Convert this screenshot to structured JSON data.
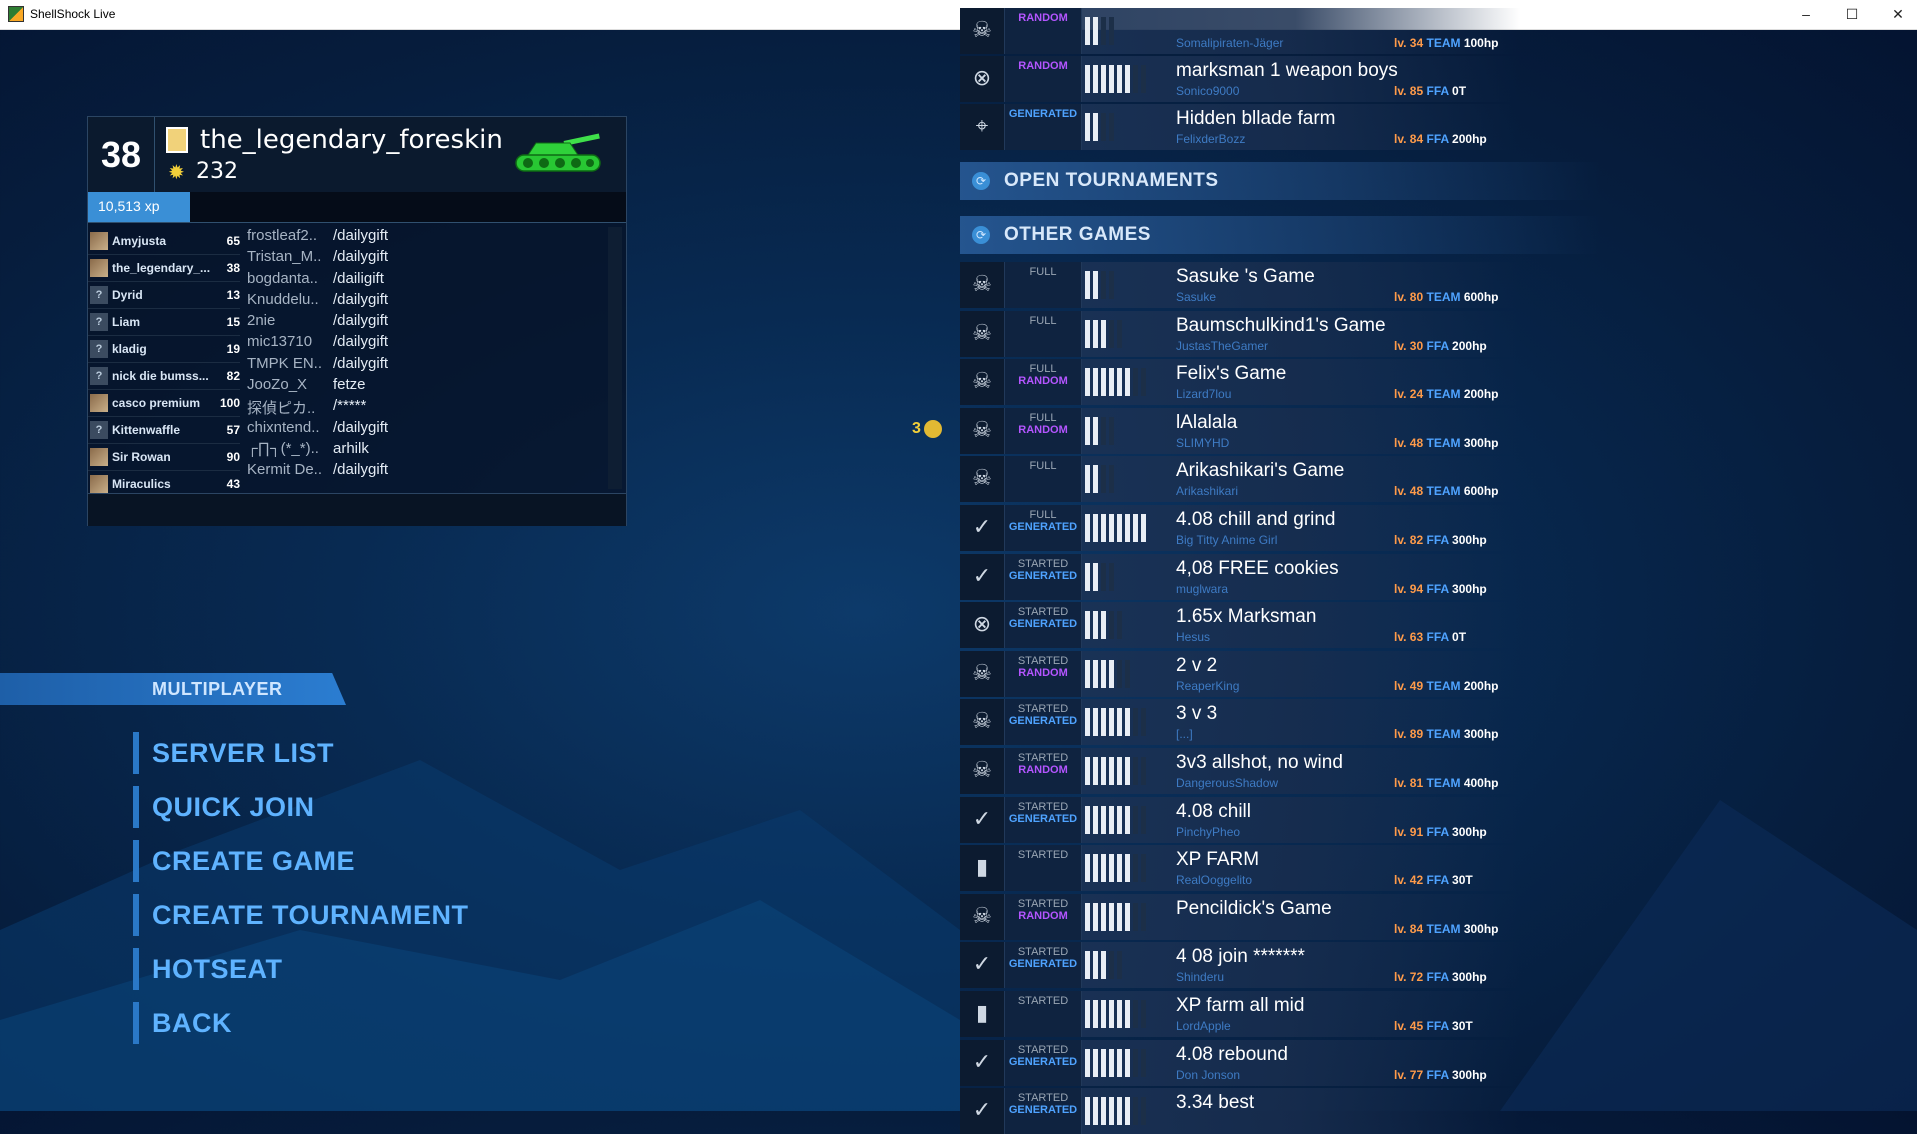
{
  "window": {
    "title": "ShellShock Live",
    "minimize": "–",
    "maximize": "☐",
    "close": "✕"
  },
  "player": {
    "level": "38",
    "name": "the_legendary_foreskin",
    "coins": "232",
    "xp_label": "10,513 xp",
    "xp_fraction": 0.19
  },
  "friends": [
    {
      "name": "Amyjusta",
      "level": "65",
      "avatar": "img"
    },
    {
      "name": "the_legendary_...",
      "level": "38",
      "avatar": "img"
    },
    {
      "name": "Dyrid",
      "level": "13",
      "avatar": "?"
    },
    {
      "name": "Liam",
      "level": "15",
      "avatar": "?"
    },
    {
      "name": "kladig",
      "level": "19",
      "avatar": "?"
    },
    {
      "name": "nick die bumss...",
      "level": "82",
      "avatar": "?"
    },
    {
      "name": "casco premium",
      "level": "100",
      "avatar": "img"
    },
    {
      "name": "Kittenwaffle",
      "level": "57",
      "avatar": "?"
    },
    {
      "name": "Sir Rowan",
      "level": "90",
      "avatar": "img"
    },
    {
      "name": "Miraculics",
      "level": "43",
      "avatar": "img"
    }
  ],
  "chat": [
    {
      "user": "frostleaf2..",
      "msg": "/dailygift"
    },
    {
      "user": "Tristan_M..",
      "msg": "/dailygift"
    },
    {
      "user": "bogdanta..",
      "msg": "/dailigift"
    },
    {
      "user": "Knuddelu..",
      "msg": "/dailygift"
    },
    {
      "user": "2nie",
      "msg": "/dailygift"
    },
    {
      "user": "mic13710",
      "msg": "/dailygift"
    },
    {
      "user": "TMPK EN..",
      "msg": "/dailygift"
    },
    {
      "user": "JooZo_X",
      "msg": "fetze"
    },
    {
      "user": "探偵ピカ..",
      "msg": "/*****"
    },
    {
      "user": "chixntend..",
      "msg": "/dailygift"
    },
    {
      "user": "┌∏┐(*_*)..",
      "msg": "arhilk"
    },
    {
      "user": "Kermit De..",
      "msg": "/dailygift"
    }
  ],
  "menu": {
    "header": "MULTIPLAYER",
    "items": [
      "SERVER LIST",
      "QUICK JOIN",
      "CREATE GAME",
      "CREATE TOURNAMENT",
      "HOTSEAT",
      "BACK"
    ]
  },
  "sections": {
    "open_tournaments": "OPEN TOURNAMENTS",
    "other_games": "OTHER GAMES"
  },
  "coin_indicator": {
    "count": "3"
  },
  "top_games": [
    {
      "icon": "☠",
      "status": "",
      "type": "RANDOM",
      "type_color": "#b455ff",
      "bars": 2,
      "name": "",
      "owner": "Somalipiraten-Jäger",
      "level": "lv. 34",
      "mode": "TEAM",
      "hp": "100hp"
    },
    {
      "icon": "⊗",
      "status": "",
      "type": "RANDOM",
      "type_color": "#b455ff",
      "bars": 6,
      "name": "marksman 1 weapon boys",
      "owner": "Sonico9000",
      "level": "lv. 85",
      "mode": "FFA",
      "hp": "0T"
    },
    {
      "icon": "⌖",
      "status": "",
      "type": "GENERATED",
      "type_color": "#4fa3ff",
      "bars": 2,
      "name": "Hidden bllade farm",
      "owner": "FelixderBozz",
      "level": "lv. 84",
      "mode": "FFA",
      "hp": "200hp"
    }
  ],
  "other_games": [
    {
      "icon": "☠",
      "status": "FULL",
      "type": "",
      "bars": 2,
      "name": "Sasuke   's Game",
      "owner": "Sasuke",
      "level": "lv. 80",
      "mode": "TEAM",
      "hp": "600hp"
    },
    {
      "icon": "☠",
      "status": "FULL",
      "type": "",
      "bars": 3,
      "name": "Baumschulkind1's Game",
      "owner": "JustasTheGamer",
      "level": "lv. 30",
      "mode": "FFA",
      "hp": "200hp"
    },
    {
      "icon": "☠",
      "status": "FULL",
      "type": "RANDOM",
      "bars": 6,
      "name": "Felix's Game",
      "owner": "Lizard7lou",
      "level": "lv. 24",
      "mode": "TEAM",
      "hp": "200hp"
    },
    {
      "icon": "☠",
      "status": "FULL",
      "type": "RANDOM",
      "bars": 2,
      "name": "lAlalala",
      "owner": "SLIMYHD",
      "level": "lv. 48",
      "mode": "TEAM",
      "hp": "300hp"
    },
    {
      "icon": "☠",
      "status": "FULL",
      "type": "",
      "bars": 2,
      "name": "Arikashikari's Game",
      "owner": "Arikashikari",
      "level": "lv. 48",
      "mode": "TEAM",
      "hp": "600hp"
    },
    {
      "icon": "✓",
      "status": "FULL",
      "type": "GENERATED",
      "bars": 8,
      "name": "4.08 chill and grind",
      "owner": "Big Titty Anime Girl",
      "level": "lv. 82",
      "mode": "FFA",
      "hp": "300hp"
    },
    {
      "icon": "✓",
      "status": "STARTED",
      "type": "GENERATED",
      "bars": 2,
      "name": "4,08 FREE cookies",
      "owner": "muglwara",
      "level": "lv. 94",
      "mode": "FFA",
      "hp": "300hp"
    },
    {
      "icon": "⊗",
      "status": "STARTED",
      "type": "GENERATED",
      "bars": 3,
      "name": "1.65x Marksman",
      "owner": "Hesus",
      "level": "lv. 63",
      "mode": "FFA",
      "hp": "0T"
    },
    {
      "icon": "☠",
      "status": "STARTED",
      "type": "RANDOM",
      "bars": 4,
      "name": "2 v 2",
      "owner": "ReaperKing",
      "level": "lv. 49",
      "mode": "TEAM",
      "hp": "200hp"
    },
    {
      "icon": "☠",
      "status": "STARTED",
      "type": "GENERATED",
      "bars": 6,
      "name": "3 v 3",
      "owner": "[...]",
      "level": "lv. 89",
      "mode": "TEAM",
      "hp": "300hp"
    },
    {
      "icon": "☠",
      "status": "STARTED",
      "type": "RANDOM",
      "bars": 6,
      "name": "3v3 allshot, no wind",
      "owner": "DangerousShadow",
      "level": "lv. 81",
      "mode": "TEAM",
      "hp": "400hp"
    },
    {
      "icon": "✓",
      "status": "STARTED",
      "type": "GENERATED",
      "bars": 6,
      "name": "4.08 chill",
      "owner": "PinchyPheo",
      "level": "lv. 91",
      "mode": "FFA",
      "hp": "300hp"
    },
    {
      "icon": "▮",
      "status": "STARTED",
      "type": "",
      "bars": 6,
      "name": "XP FARM",
      "owner": "RealOoggelito",
      "level": "lv. 42",
      "mode": "FFA",
      "hp": "30T"
    },
    {
      "icon": "☠",
      "status": "STARTED",
      "type": "RANDOM",
      "bars": 6,
      "name": "Pencildick's Game",
      "owner": "",
      "level": "lv. 84",
      "mode": "TEAM",
      "hp": "300hp"
    },
    {
      "icon": "✓",
      "status": "STARTED",
      "type": "GENERATED",
      "bars": 3,
      "name": "4 08 join *******",
      "owner": "Shinderu",
      "level": "lv. 72",
      "mode": "FFA",
      "hp": "300hp"
    },
    {
      "icon": "▮",
      "status": "STARTED",
      "type": "",
      "bars": 6,
      "name": "XP farm all mid",
      "owner": "LordApple",
      "level": "lv. 45",
      "mode": "FFA",
      "hp": "30T"
    },
    {
      "icon": "✓",
      "status": "STARTED",
      "type": "GENERATED",
      "bars": 6,
      "name": "4.08 rebound",
      "owner": "Don Jonson",
      "level": "lv. 77",
      "mode": "FFA",
      "hp": "300hp"
    },
    {
      "icon": "✓",
      "status": "STARTED",
      "type": "GENERATED",
      "bars": 6,
      "name": "3.34 best",
      "owner": "",
      "level": "",
      "mode": "",
      "hp": ""
    }
  ]
}
